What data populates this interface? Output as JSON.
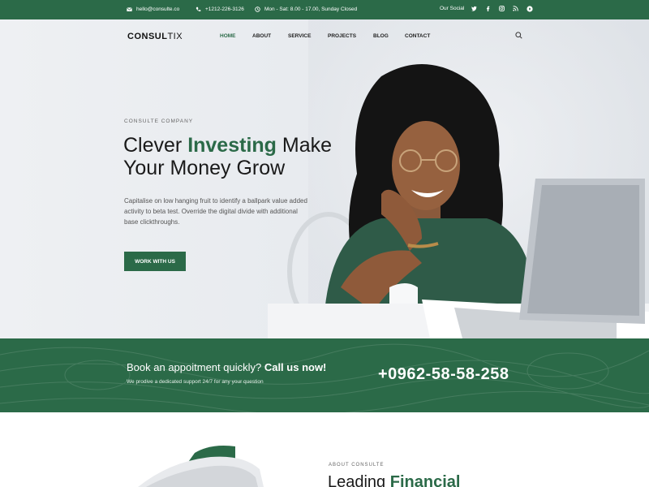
{
  "topbar": {
    "email": "hello@consulte.co",
    "phone": "+1212-226-3126",
    "hours": "Mon - Sat: 8.00 - 17.00, Sunday Closed",
    "social_label": "Our Social",
    "social_icons": [
      "twitter-icon",
      "facebook-icon",
      "instagram-icon",
      "rss-icon",
      "youtube-icon"
    ]
  },
  "nav": {
    "logo_bold": "CONSUL",
    "logo_light": "TIX",
    "items": [
      "HOME",
      "ABOUT",
      "SERVICE",
      "PROJECTS",
      "BLOG",
      "CONTACT"
    ],
    "active": "HOME"
  },
  "hero": {
    "tag": "CONSULTE COMPANY",
    "headline_a": "Clever ",
    "headline_highlight": "Investing",
    "headline_b": " Make",
    "headline_c": "Your Money Grow",
    "description": "Capitalise on low hanging fruit to identify a ballpark value added activity to beta test. Override the digital divide with additional base clickthroughs.",
    "cta": "WORK WITH US"
  },
  "band": {
    "title_a": "Book an appoitment quickly? ",
    "title_b": "Call us now!",
    "subtitle": "We prodive a dedicated support 24/7 for any your question",
    "phone": "+0962-58-58-258"
  },
  "about": {
    "tag": "ABOUT CONSULTE",
    "head_a": "Leading ",
    "head_b": "Financial"
  },
  "colors": {
    "accent": "#2b6a48",
    "text": "#1a1a1a"
  }
}
